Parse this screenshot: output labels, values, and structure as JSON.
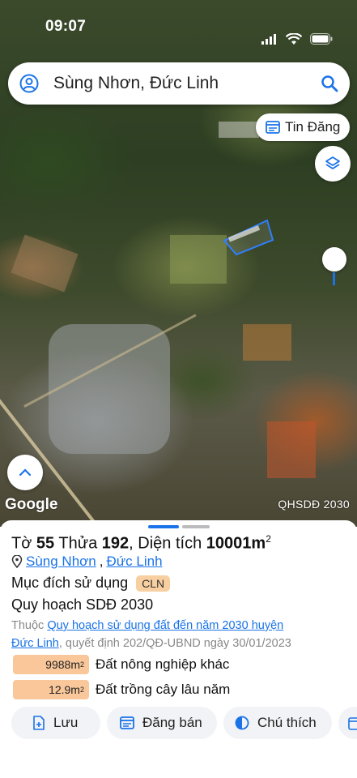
{
  "status_bar": {
    "time": "09:07"
  },
  "search": {
    "query": "Sùng Nhơn, Đức Linh"
  },
  "map": {
    "tin_dang_label": "Tin Đăng",
    "google_label": "Google",
    "layer_label": "QHSDĐ 2030"
  },
  "parcel": {
    "to_label": "Tờ",
    "to_value": "55",
    "thua_label": "Thửa",
    "thua_value": "192",
    "area_label": "Diện tích",
    "area_value": "10001m",
    "area_unit_sup": "2",
    "commune": "Sùng Nhơn",
    "district": "Đức Linh",
    "purpose_label": "Mục đích sử dụng",
    "purpose_code": "CLN",
    "plan_title": "Quy hoạch SDĐ 2030",
    "desc_prefix": "Thuộc",
    "desc_link_part1": "Quy hoạch sử dụng đất đến năm 2030 huyện",
    "desc_link_part2": "Đức Linh",
    "desc_suffix": ", quyết định 202/QĐ-UBND ngày 30/01/2023",
    "areas": [
      {
        "value": "9988m",
        "sup": "2",
        "label": "Đất nông nghiệp khác"
      },
      {
        "value": "12.9m",
        "sup": "2",
        "label": "Đất trồng cây lâu năm"
      }
    ]
  },
  "actions": {
    "save": "Lưu",
    "post": "Đăng bán",
    "legend": "Chú thích"
  },
  "colors": {
    "accent": "#1a73e8",
    "badge": "#f8cfa0",
    "area_box": "#f9c79a"
  }
}
